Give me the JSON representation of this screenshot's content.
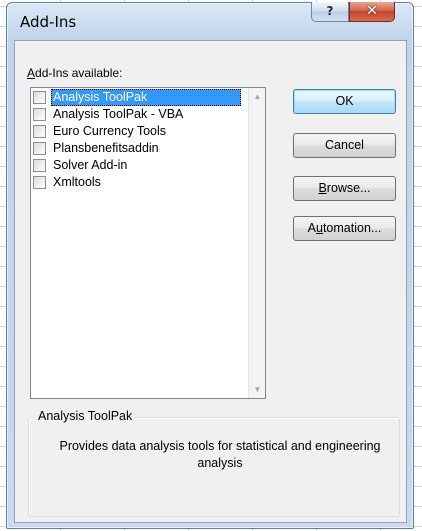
{
  "window": {
    "title": "Add-Ins",
    "help_glyph": "?",
    "close_glyph": "✕"
  },
  "addins": {
    "label_prefix": "",
    "label_accel": "A",
    "label_rest": "dd-Ins available:",
    "items": [
      {
        "label": "Analysis ToolPak",
        "checked": false,
        "selected": true
      },
      {
        "label": "Analysis ToolPak - VBA",
        "checked": false,
        "selected": false
      },
      {
        "label": "Euro Currency Tools",
        "checked": false,
        "selected": false
      },
      {
        "label": "Plansbenefitsaddin",
        "checked": false,
        "selected": false
      },
      {
        "label": "Solver Add-in",
        "checked": false,
        "selected": false
      },
      {
        "label": "Xmltools",
        "checked": false,
        "selected": false
      }
    ]
  },
  "buttons": {
    "ok": "OK",
    "cancel": "Cancel",
    "browse_accel": "B",
    "browse_rest": "rowse...",
    "automation_pre": "A",
    "automation_accel": "u",
    "automation_rest": "tomation..."
  },
  "description": {
    "group_title": "Analysis ToolPak",
    "text": "Provides data analysis tools for statistical and engineering analysis"
  },
  "colors": {
    "selection": "#3399ff",
    "title_bar": "#c6d8ee",
    "close_button": "#c2432b"
  }
}
